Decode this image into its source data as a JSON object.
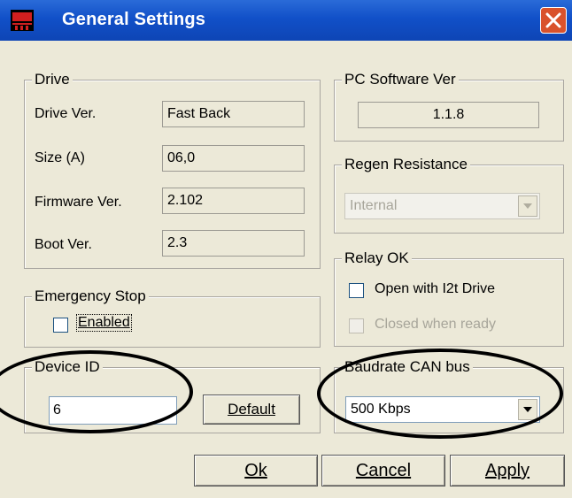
{
  "window": {
    "title": "General  Settings",
    "close_icon": "close-icon",
    "app_icon": "app-logo-icon"
  },
  "drive": {
    "legend": "Drive",
    "rows": [
      {
        "label": "Drive Ver.",
        "value": "Fast Back"
      },
      {
        "label": "Size (A)",
        "value": "06,0"
      },
      {
        "label": "Firmware Ver.",
        "value": "2.102"
      },
      {
        "label": "Boot Ver.",
        "value": "2.3"
      }
    ]
  },
  "pc_software": {
    "legend": "PC Software Ver",
    "value": "1.1.8"
  },
  "regen": {
    "legend": "Regen Resistance",
    "selected": "Internal",
    "disabled": true
  },
  "relay": {
    "legend": "Relay OK",
    "option1": "Open with I2t Drive",
    "option2": "Closed when ready"
  },
  "emergency": {
    "legend": "Emergency Stop",
    "checkbox_label": "Enabled"
  },
  "device_id": {
    "legend": "Device ID",
    "value": "6",
    "default_button": "Default"
  },
  "baudrate": {
    "legend": "Baudrate CAN bus",
    "selected": "500 Kbps"
  },
  "buttons": {
    "ok": "Ok",
    "cancel": "Cancel",
    "apply": "Apply"
  },
  "colors": {
    "title_bar": "#0e45b5",
    "dialog_bg": "#ece9d8",
    "close_button": "#d9522c"
  }
}
